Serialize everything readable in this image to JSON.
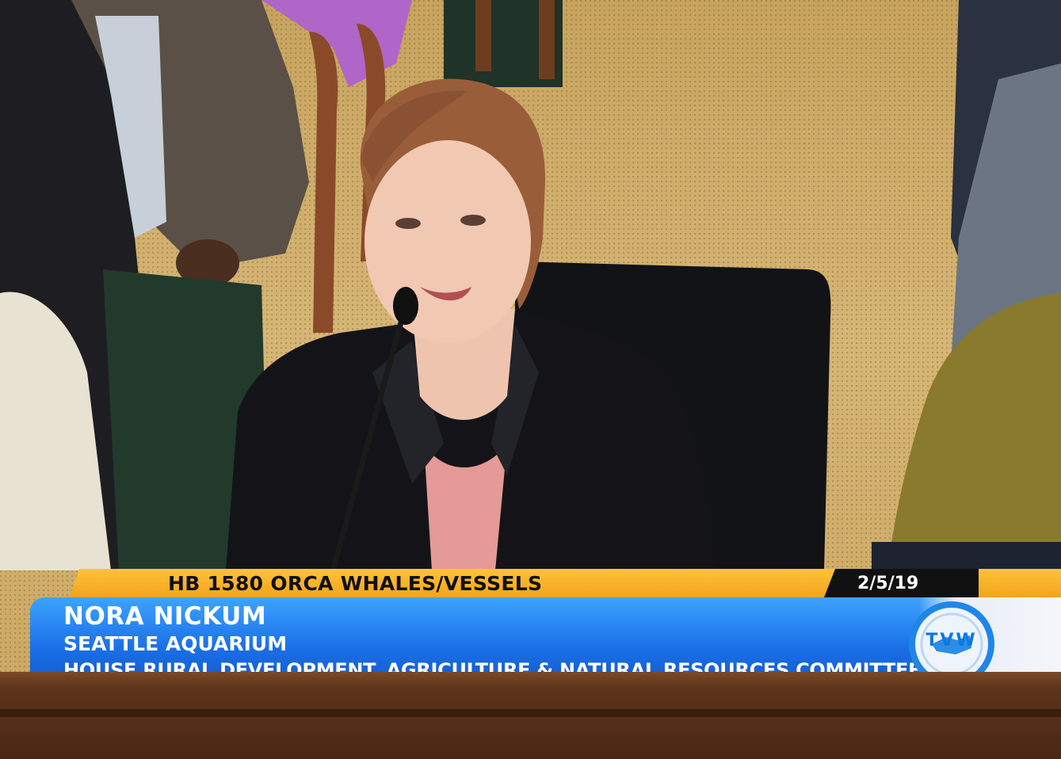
{
  "broadcast": {
    "bill_topic": "HB 1580  ORCA WHALES/VESSELS",
    "date": "2/5/19",
    "speaker_name": "NORA NICKUM",
    "speaker_org": "SEATTLE AQUARIUM",
    "committee": "HOUSE RURAL DEVELOPMENT,  AGRICULTURE & NATURAL RESOURCES COMMITTEE",
    "network_logo": "TVW"
  },
  "colors": {
    "topbar": "#f2a41c",
    "bluebar": "#1a6fe6",
    "date_box": "#111111",
    "text_light": "#ffffff",
    "text_dark": "#101010"
  }
}
